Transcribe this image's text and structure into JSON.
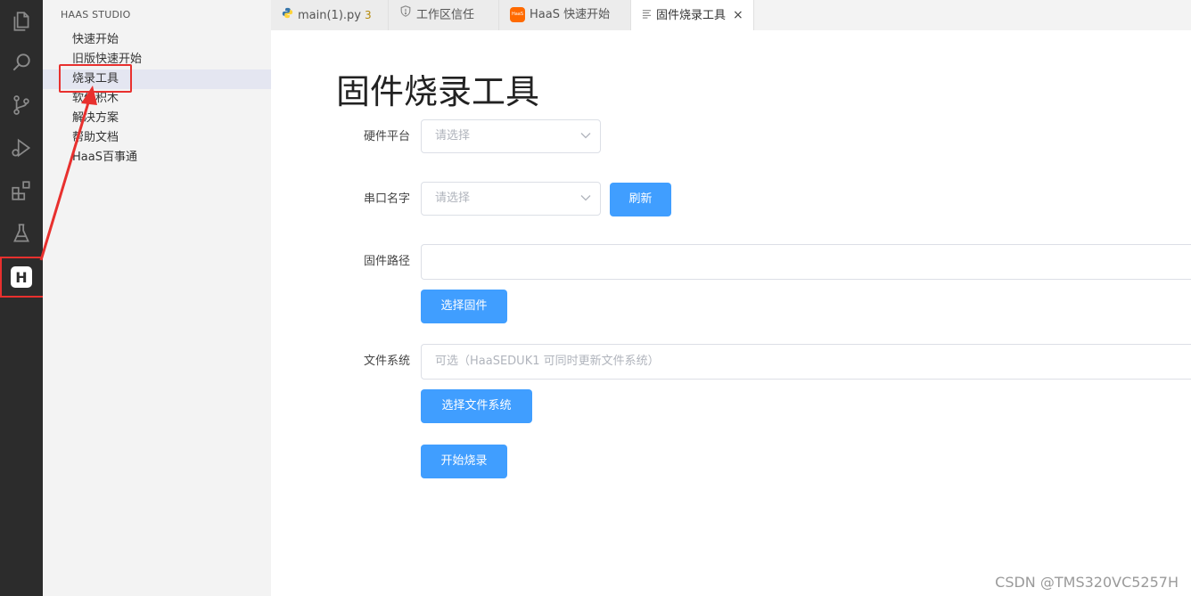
{
  "activity_bar": {
    "icons": [
      "files-icon",
      "search-icon",
      "source-control-icon",
      "run-debug-icon",
      "extensions-icon",
      "testing-flask-icon"
    ],
    "haas_badge": "H"
  },
  "sidebar": {
    "title": "HAAS STUDIO",
    "items": [
      {
        "label": "快速开始"
      },
      {
        "label": "旧版快速开始"
      },
      {
        "label": "烧录工具"
      },
      {
        "label": "软件积木"
      },
      {
        "label": "解决方案"
      },
      {
        "label": "帮助文档"
      },
      {
        "label": "HaaS百事通"
      }
    ]
  },
  "tabs": [
    {
      "label": "main(1).py",
      "badge": "3",
      "icon": "python-icon"
    },
    {
      "label": "工作区信任",
      "icon": "shield-icon"
    },
    {
      "label": "HaaS 快速开始",
      "icon": "haas-logo-icon",
      "logo_text": "HaaS"
    },
    {
      "label": "固件烧录工具",
      "icon": "preview-icon",
      "close": "×"
    }
  ],
  "main": {
    "title": "固件烧录工具",
    "hardware_platform": {
      "label": "硬件平台",
      "placeholder": "请选择"
    },
    "serial_port": {
      "label": "串口名字",
      "placeholder": "请选择",
      "refresh_label": "刷新"
    },
    "firmware_path": {
      "label": "固件路径",
      "value": "",
      "select_label": "选择固件"
    },
    "file_system": {
      "label": "文件系统",
      "placeholder": "可选（HaaSEDUK1 可同时更新文件系统）",
      "select_label": "选择文件系统"
    },
    "start_label": "开始烧录"
  },
  "watermark": "CSDN @TMS320VC5257H",
  "colors": {
    "primary": "#409eff",
    "activity_bg": "#2c2c2c",
    "sidebar_bg": "#f3f3f3",
    "highlight_red": "#e8302e"
  }
}
